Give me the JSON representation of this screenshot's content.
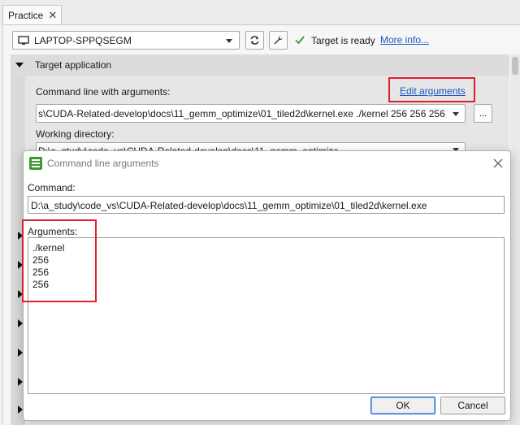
{
  "tab": {
    "title": "Practice",
    "close_glyph": "✕"
  },
  "toolbar": {
    "machine": "LAPTOP-SPPQSEGM",
    "status_text": "Target is ready",
    "more_info_label": "More info..."
  },
  "section": {
    "title": "Target application",
    "cmdline_label": "Command line with arguments:",
    "edit_args_label": "Edit arguments",
    "cmdline_value": "s\\CUDA-Related-develop\\docs\\11_gemm_optimize\\01_tiled2d\\kernel.exe ./kernel 256 256 256",
    "browse_label": "...",
    "workdir_label": "Working directory:",
    "workdir_value": "D:\\a_study\\code_vs\\CUDA-Related-develop\\docs\\11_gemm_optimize"
  },
  "dialog": {
    "title": "Command line arguments",
    "command_label": "Command:",
    "command_value": "D:\\a_study\\code_vs\\CUDA-Related-develop\\docs\\11_gemm_optimize\\01_tiled2d\\kernel.exe",
    "arguments_label": "Arguments:",
    "arguments": [
      "./kernel",
      "256",
      "256",
      "256"
    ],
    "ok_label": "OK",
    "cancel_label": "Cancel"
  },
  "colors": {
    "accent": "#1a56c4",
    "highlight_box": "#e0202f",
    "ready_check": "#2e9b3e"
  }
}
